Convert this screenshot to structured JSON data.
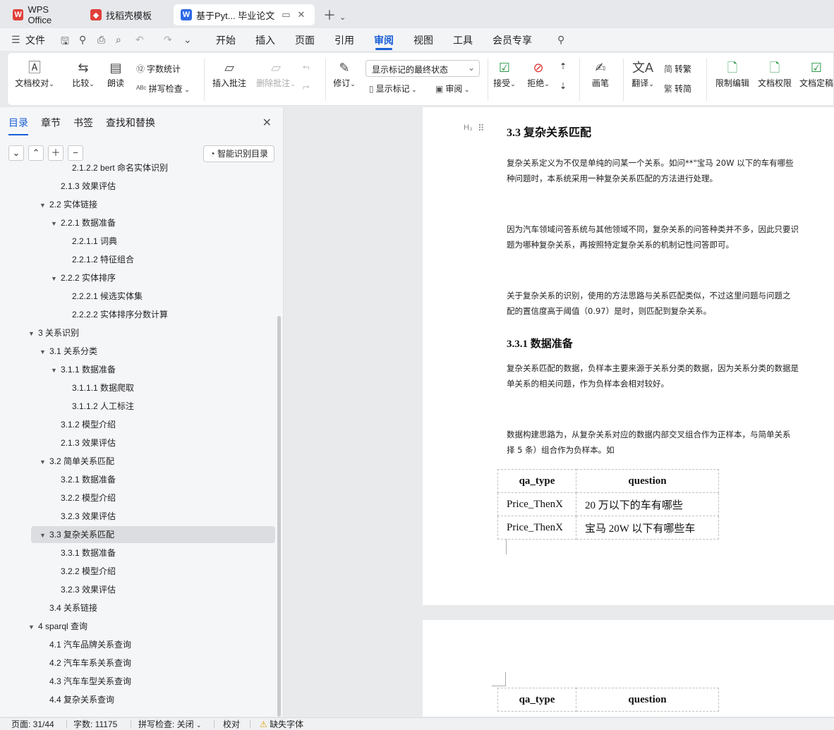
{
  "tabs": {
    "wps": "WPS Office",
    "template": "找稻壳模板",
    "doc": "基于Pyt... 毕业论文"
  },
  "menu": {
    "file": "文件",
    "items": [
      "开始",
      "插入",
      "页面",
      "引用",
      "审阅",
      "视图",
      "工具",
      "会员专享"
    ],
    "active": "审阅"
  },
  "ribbon": {
    "proofread": "文档校对",
    "compare": "比较",
    "read_aloud": "朗读",
    "word_count": "字数统计",
    "spell_check": "拼写检查",
    "insert_comment": "插入批注",
    "delete_comment": "删除批注",
    "revise": "修订",
    "display_state": "显示标记的最终状态",
    "show_marks": "显示标记",
    "review": "审阅",
    "accept": "接受",
    "reject": "拒绝",
    "pen": "画笔",
    "translate": "翻译",
    "to_traditional": "转繁",
    "to_simplified": "转简",
    "restrict_edit": "限制编辑",
    "doc_rights": "文档权限",
    "finalize": "文档定稿"
  },
  "nav": {
    "tabs": [
      "目录",
      "章节",
      "书签",
      "查找和替换"
    ],
    "smart_toc": "智能识别目录",
    "items": [
      {
        "label": "2.1.2.2 bert 命名实体识别",
        "level": 4,
        "caret": false
      },
      {
        "label": "2.1.3  效果评估",
        "level": 3,
        "caret": false
      },
      {
        "label": "2.2  实体链接",
        "level": 2,
        "caret": true
      },
      {
        "label": "2.2.1  数据准备",
        "level": 3,
        "caret": true
      },
      {
        "label": "2.2.1.1  词典",
        "level": 4,
        "caret": false
      },
      {
        "label": "2.2.1.2  特征组合",
        "level": 4,
        "caret": false
      },
      {
        "label": "2.2.2  实体排序",
        "level": 3,
        "caret": true
      },
      {
        "label": "2.2.2.1  候选实体集",
        "level": 4,
        "caret": false
      },
      {
        "label": "2.2.2.2  实体排序分数计算",
        "level": 4,
        "caret": false
      },
      {
        "label": "3  关系识别",
        "level": 1,
        "caret": true
      },
      {
        "label": "3.1  关系分类",
        "level": 2,
        "caret": true
      },
      {
        "label": "3.1.1  数据准备",
        "level": 3,
        "caret": true
      },
      {
        "label": "3.1.1.1  数据爬取",
        "level": 4,
        "caret": false
      },
      {
        "label": "3.1.1.2  人工标注",
        "level": 4,
        "caret": false
      },
      {
        "label": "3.1.2  模型介绍",
        "level": 3,
        "caret": false
      },
      {
        "label": "2.1.3  效果评估",
        "level": 3,
        "caret": false
      },
      {
        "label": "3.2  简单关系匹配",
        "level": 2,
        "caret": true
      },
      {
        "label": "3.2.1  数据准备",
        "level": 3,
        "caret": false
      },
      {
        "label": "3.2.2  模型介绍",
        "level": 3,
        "caret": false
      },
      {
        "label": "3.2.3  效果评估",
        "level": 3,
        "caret": false
      },
      {
        "label": "3.3  复杂关系匹配",
        "level": 2,
        "caret": true,
        "selected": true
      },
      {
        "label": "3.3.1  数据准备",
        "level": 3,
        "caret": false
      },
      {
        "label": "3.2.2  模型介绍",
        "level": 3,
        "caret": false
      },
      {
        "label": "3.2.3  效果评估",
        "level": 3,
        "caret": false
      },
      {
        "label": "3.4  关系链接",
        "level": 2,
        "caret": false
      },
      {
        "label": "4  sparql  查询",
        "level": 1,
        "caret": true
      },
      {
        "label": "4.1  汽车品牌关系查询",
        "level": 2,
        "caret": false
      },
      {
        "label": "4.2  汽车车系关系查询",
        "level": 2,
        "caret": false
      },
      {
        "label": "4.3  汽车车型关系查询",
        "level": 2,
        "caret": false
      },
      {
        "label": "4.4  复杂关系查询",
        "level": 2,
        "caret": false
      }
    ]
  },
  "doc": {
    "heading_marker": "H₃",
    "h2": "3.3  复杂关系匹配",
    "p1a": "复杂关系定义为不仅是单纯的问某一个关系。如问**\"宝马 20W 以下的车有哪些",
    "p1b": "种问题时，本系统采用一种复杂关系匹配的方法进行处理。",
    "p2a": "因为汽车领域问答系统与其他领域不同，复杂关系的问答种类并不多，因此只要识",
    "p2b": "题为哪种复杂关系，再按照特定复杂关系的机制记性问答即可。",
    "p3a": "关于复杂关系的识别，使用的方法思路与关系匹配类似，不过这里问题与问题之",
    "p3b": "配的置信度高于阈值（0.97）是时，则匹配到复杂关系。",
    "h3": "3.3.1  数据准备",
    "p4a": "复杂关系匹配的数据，负样本主要来源于关系分类的数据，因为关系分类的数据是",
    "p4b": "单关系的相关问题，作为负样本会相对较好。",
    "p5a": "数据构建思路为，从复杂关系对应的数据内部交叉组合作为正样本，与简单关系",
    "p5b": "择 5 条）组合作为负样本。如",
    "table": {
      "headers": [
        "qa_type",
        "question"
      ],
      "rows": [
        [
          "Price_ThenX",
          "20  万以下的车有哪些"
        ],
        [
          "Price_ThenX",
          "宝马  20W  以下有哪些车"
        ]
      ]
    },
    "page2_headers": [
      "qa_type",
      "question"
    ]
  },
  "status": {
    "page": "页面: 31/44",
    "words": "字数: 11175",
    "spell": "拼写检查: 关闭",
    "proof": "校对",
    "missing_font": "缺失字体"
  },
  "colors": {
    "accent": "#1a5fd6",
    "wps_red": "#e0403a",
    "doc_blue": "#2f6ae6"
  }
}
